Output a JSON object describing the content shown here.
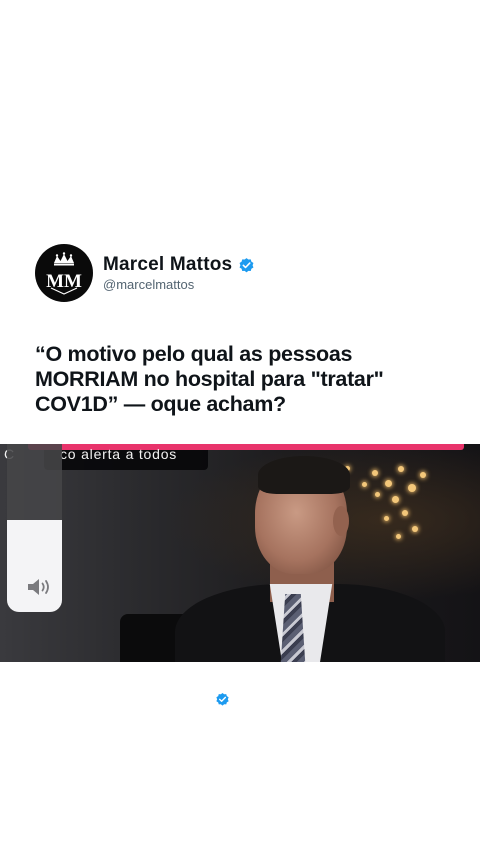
{
  "tweet": {
    "display_name": "Marcel Mattos",
    "handle": "@marcelmattos",
    "avatar_initials": "MM",
    "verified": true,
    "text": "“O motivo pelo qual as pessoas MORRIAM no hospital para \"tratar\" COV1D” — oque acham?"
  },
  "video": {
    "caption_left": "C",
    "caption": "co  alerta  a todos",
    "volume_level": 0.55
  },
  "colors": {
    "verified_blue": "#1d9bf0",
    "progress_accent": "#e8336b",
    "text_primary": "#0f1419",
    "text_secondary": "#536471"
  },
  "icons": {
    "verified": "verified-badge-icon",
    "volume": "speaker-icon"
  }
}
